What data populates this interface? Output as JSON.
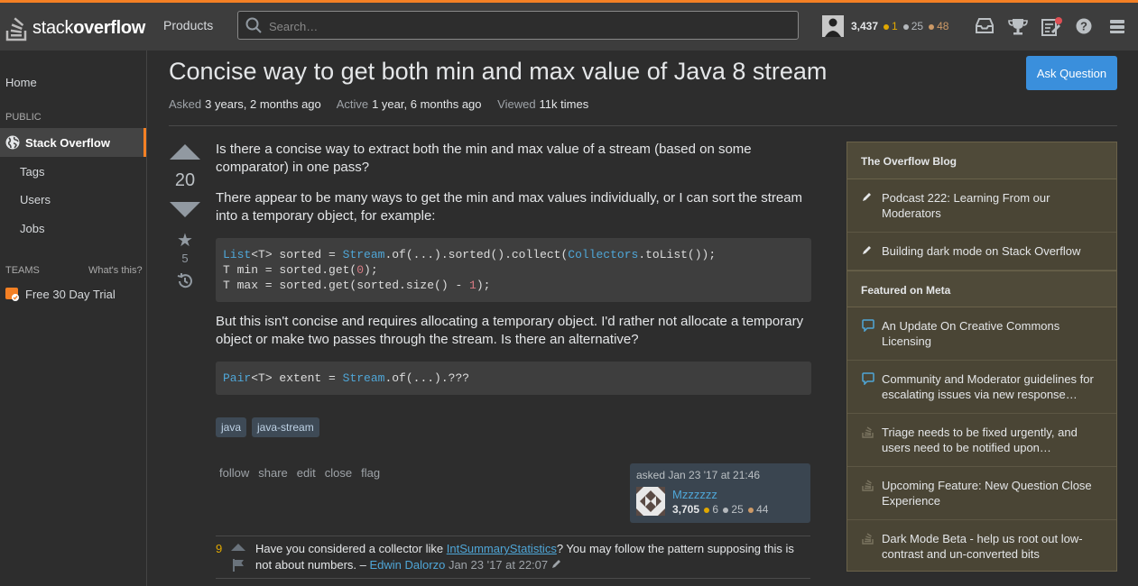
{
  "header": {
    "logo_text_light": "stack",
    "logo_text_bold": "overflow",
    "products": "Products",
    "search_placeholder": "Search…",
    "reputation": "3,437",
    "gold": "1",
    "silver": "25",
    "bronze": "48"
  },
  "sidebar": {
    "home": "Home",
    "public": "PUBLIC",
    "stack_overflow": "Stack Overflow",
    "tags": "Tags",
    "users": "Users",
    "jobs": "Jobs",
    "teams": "TEAMS",
    "whats_this": "What's this?",
    "trial": "Free 30 Day Trial"
  },
  "question": {
    "title": "Concise way to get both min and max value of Java 8 stream",
    "ask_button": "Ask Question",
    "asked_label": "Asked",
    "asked_value": "3 years, 2 months ago",
    "active_label": "Active",
    "active_value": "1 year, 6 months ago",
    "viewed_label": "Viewed",
    "viewed_value": "11k times",
    "votes": "20",
    "favorites": "5",
    "p1": "Is there a concise way to extract both the min and max value of a stream (based on some comparator) in one pass?",
    "p2": "There appear to be many ways to get the min and max values individually, or I can sort the stream into a temporary object, for example:",
    "code1": {
      "l1_type": "List",
      "l1_a": "<T> sorted = ",
      "l1_stream": "Stream",
      "l1_b": ".of(...).sorted().collect(",
      "l1_coll": "Collectors",
      "l1_c": ".toList());",
      "l2_a": "T min = sorted.get(",
      "l2_num": "0",
      "l2_b": ");",
      "l3_a": "T max = sorted.get(sorted.size() - ",
      "l3_num": "1",
      "l3_b": ");"
    },
    "p3": "But this isn't concise and requires allocating a temporary object. I'd rather not allocate a temporary object or make two passes through the stream. Is there an alternative?",
    "code2": {
      "type": "Pair",
      "a": "<T> extent = ",
      "stream": "Stream",
      "b": ".of(...).???"
    },
    "tags": [
      "java",
      "java-stream"
    ],
    "actions": [
      "follow",
      "share",
      "edit",
      "close",
      "flag"
    ],
    "asker": {
      "asked_time": "asked Jan 23 '17 at 21:46",
      "name": "Mzzzzzz",
      "rep": "3,705",
      "gold": "6",
      "silver": "25",
      "bronze": "44"
    }
  },
  "comment": {
    "score": "9",
    "text_before": "Have you considered a collector like ",
    "link": "IntSummaryStatistics",
    "text_after": "? You may follow the pattern supposing this is not about numbers. – ",
    "user": "Edwin Dalorzo",
    "time": "Jan 23 '17 at 22:07"
  },
  "blog": {
    "heading1": "The Overflow Blog",
    "items1": [
      "Podcast 222: Learning From our Moderators",
      "Building dark mode on Stack Overflow"
    ],
    "heading2": "Featured on Meta",
    "items2": [
      "An Update On Creative Commons Licensing",
      "Community and Moderator guidelines for escalating issues via new response…",
      "Triage needs to be fixed urgently, and users need to be notified upon…",
      "Upcoming Feature: New Question Close Experience",
      "Dark Mode Beta - help us root out low-contrast and un-converted bits"
    ]
  },
  "colors": {
    "accent": "#f48024",
    "link": "#4fa6d7",
    "ask_button": "#3a8fdc",
    "blog_bg": "#4a4535"
  }
}
